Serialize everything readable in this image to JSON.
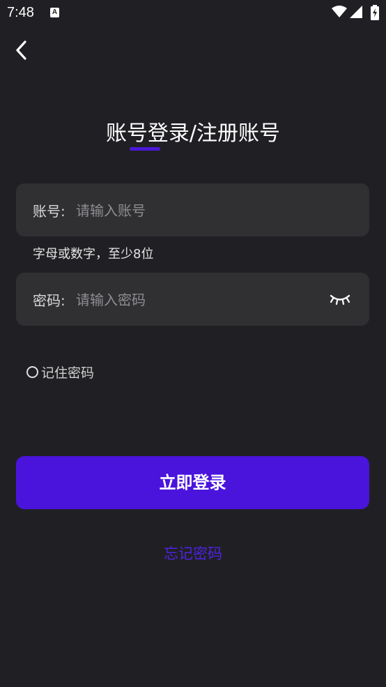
{
  "status_bar": {
    "time": "7:48",
    "notification_icon": "A"
  },
  "header": {
    "back_icon": "chevron-left-icon",
    "title": "账号登录/注册账号"
  },
  "form": {
    "account": {
      "label": "账号:",
      "placeholder": "请输入账号",
      "value": ""
    },
    "account_hint": "字母或数字，至少8位",
    "password": {
      "label": "密码:",
      "placeholder": "请输入密码",
      "value": "",
      "toggle_icon": "eye-closed-icon"
    },
    "remember_label": "记住密码",
    "remember_checked": false
  },
  "actions": {
    "login_label": "立即登录",
    "forgot_label": "忘记密码"
  },
  "colors": {
    "background": "#202024",
    "input_background": "#303033",
    "accent": "#4a14dc"
  }
}
